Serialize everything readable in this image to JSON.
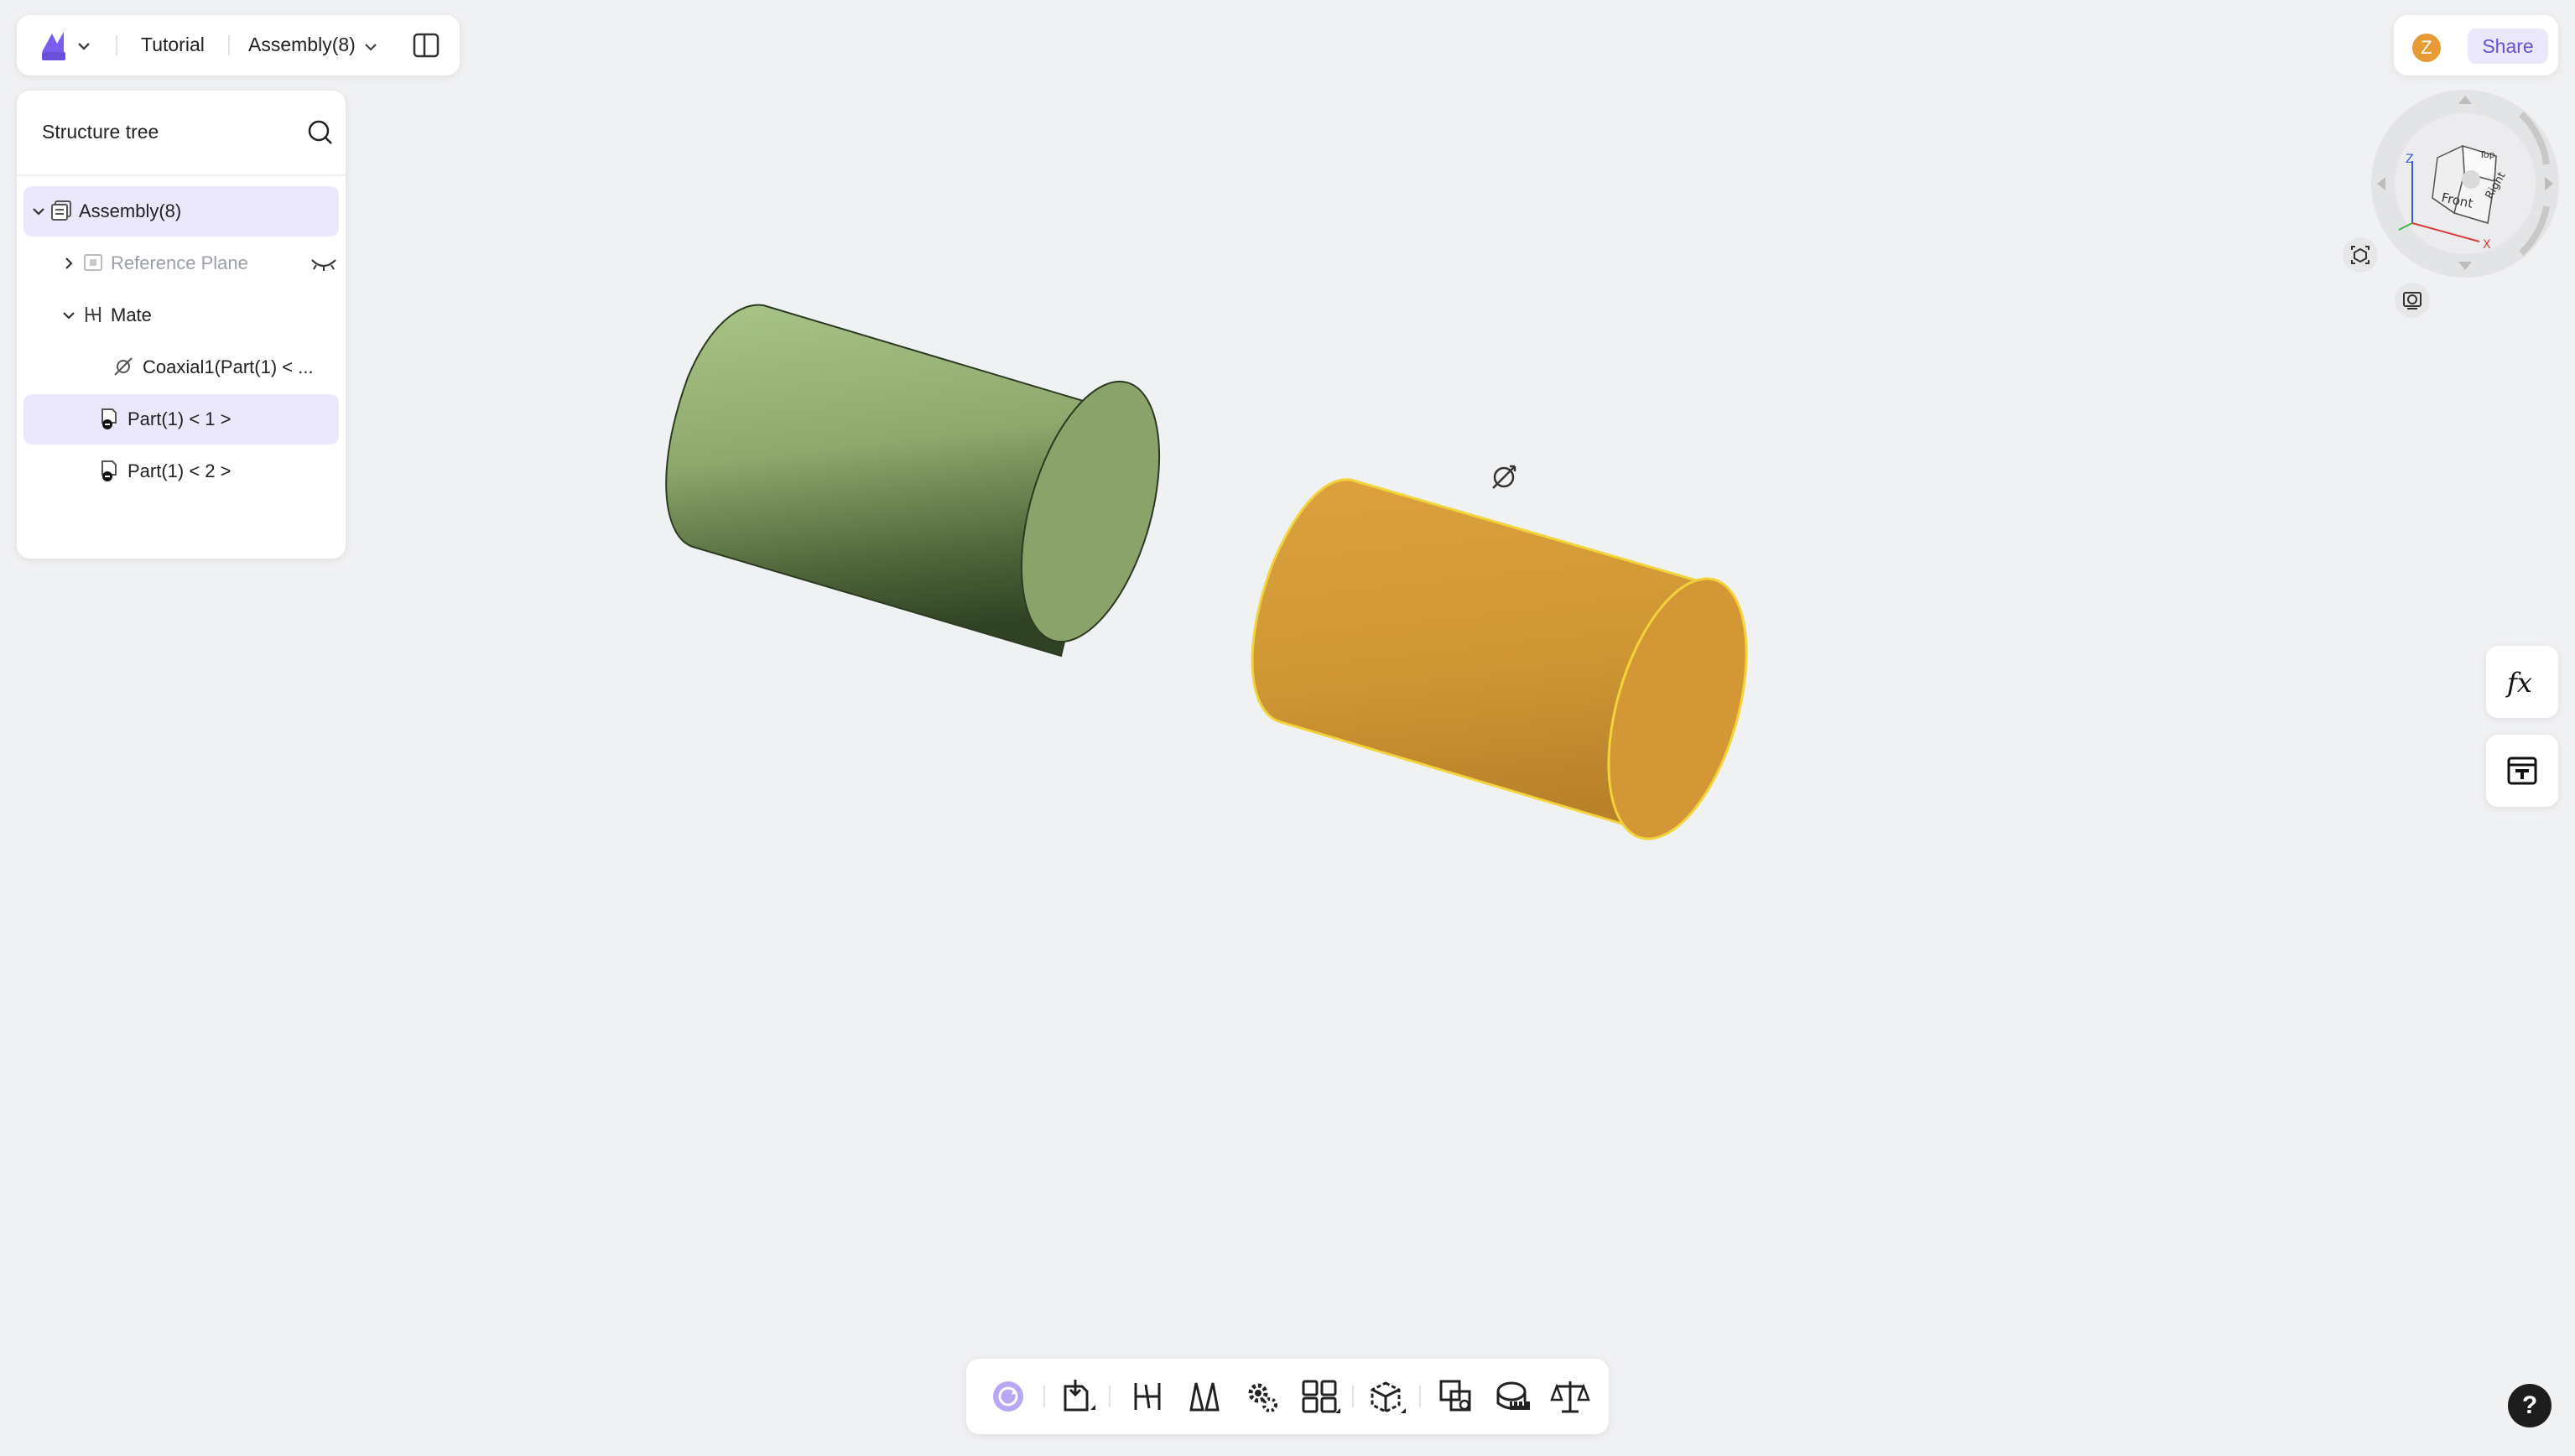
{
  "topbar": {
    "breadcrumb": "Tutorial",
    "document": "Assembly(8)",
    "logo_color": "#6b4fd8"
  },
  "share": {
    "avatar_initial": "Z",
    "share_label": "Share",
    "avatar_color": "#e89b35"
  },
  "tree": {
    "title": "Structure tree",
    "items": [
      {
        "label": "Assembly(8)",
        "icon": "assembly-icon"
      },
      {
        "label": "Reference Plane",
        "icon": "reference-plane-icon",
        "hidden": true
      },
      {
        "label": "Mate",
        "icon": "mate-icon"
      },
      {
        "label": "Coaxial1(Part(1) < ...",
        "icon": "coaxial-icon"
      },
      {
        "label": "Part(1) < 1 >",
        "icon": "part-icon",
        "selected": true
      },
      {
        "label": "Part(1) < 2 >",
        "icon": "part-icon"
      }
    ]
  },
  "viewcube": {
    "faces": [
      "Top",
      "Front",
      "Right"
    ],
    "axes": [
      "Z",
      "X"
    ]
  },
  "viewport": {
    "part1_color": "#8da86a",
    "part2_color": "#d89b37"
  },
  "side_buttons": [
    "fx-icon",
    "variable-table-icon"
  ],
  "toolbar": {
    "icons": [
      "rotate-icon",
      "insert-part-icon",
      "mate-tool-icon",
      "mirror-icon",
      "gear-icon",
      "pattern-icon",
      "explode-icon",
      "interference-icon",
      "measure-icon",
      "mass-properties-icon"
    ]
  },
  "help_label": "?"
}
